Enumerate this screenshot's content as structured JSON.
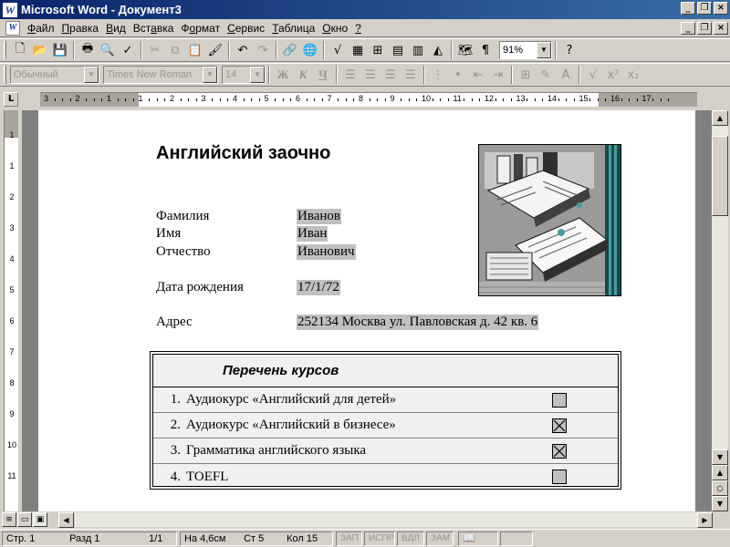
{
  "window": {
    "title": "Microsoft Word - Документ3"
  },
  "menu": [
    {
      "key": "Ф",
      "rest": "айл"
    },
    {
      "key": "П",
      "rest": "равка"
    },
    {
      "key": "В",
      "rest": "ид"
    },
    {
      "key": "",
      "pre": "Вст",
      "key2": "а",
      "rest": "вка"
    },
    {
      "key": "",
      "pre": "Ф",
      "key2": "о",
      "rest": "рмат"
    },
    {
      "key": "С",
      "rest": "ервис"
    },
    {
      "key": "Т",
      "rest": "аблица"
    },
    {
      "key": "О",
      "rest": "кно"
    },
    {
      "key": "?",
      "rest": ""
    }
  ],
  "toolbar": {
    "zoom": "91%"
  },
  "format_toolbar": {
    "style": "Обычный",
    "font": "Times New Roman",
    "size": "14"
  },
  "document": {
    "title": "Английский заочно",
    "fields": {
      "last_name": {
        "label": "Фамилия",
        "value": "Иванов"
      },
      "first_name": {
        "label": "Имя",
        "value": "Иван"
      },
      "patronymic": {
        "label": "Отчество",
        "value": "Иванович"
      },
      "birth_date": {
        "label": "Дата рождения",
        "value": "17/1/72"
      },
      "address": {
        "label": "Адрес",
        "value": "252134 Москва ул. Павловская д. 42 кв. 6"
      }
    },
    "courses": {
      "header": "Перечень курсов",
      "items": [
        {
          "num": "1.",
          "name": "Аудиокурс «Английский для детей»",
          "checked": false
        },
        {
          "num": "2.",
          "name": "Аудиокурс «Английский в бизнесе»",
          "checked": true
        },
        {
          "num": "3.",
          "name": "Грамматика английского языка",
          "checked": true
        },
        {
          "num": "4.",
          "name": "TOEFL",
          "checked": false
        }
      ]
    }
  },
  "ruler": {
    "labels": [
      "3",
      "2",
      "1",
      "1",
      "2",
      "3",
      "4",
      "5",
      "6",
      "7",
      "8",
      "9",
      "10",
      "11",
      "12",
      "13",
      "14",
      "15",
      "16",
      "17"
    ],
    "vlabels": [
      "1",
      "1",
      "2",
      "3",
      "4",
      "5",
      "6",
      "7",
      "8",
      "9",
      "10",
      "11"
    ]
  },
  "status": {
    "page": "Стр. 1",
    "section": "Разд 1",
    "pages": "1/1",
    "at": "На 4,6см",
    "line": "Ст 5",
    "col": "Кол 15",
    "rec": "ЗАП",
    "trk": "ИСПР",
    "ext": "ВДЛ",
    "ovr": "ЗАМ"
  }
}
